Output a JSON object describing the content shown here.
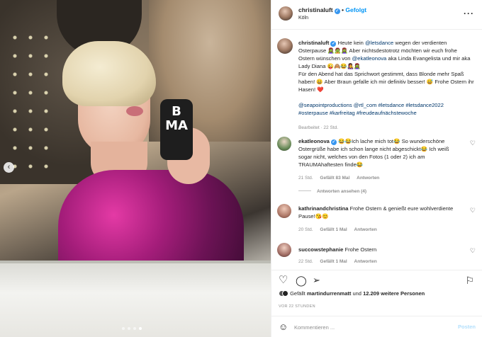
{
  "media": {
    "phone_text": "B\nMA",
    "carousel": {
      "slides": 4,
      "active_index": 3
    }
  },
  "post": {
    "author": "christinaluft",
    "follow_status": "Gefolgt",
    "location": "Köln",
    "more_icon": "more-horizontal-icon"
  },
  "caption": {
    "author": "christinaluft",
    "p1_a": "Heute kein ",
    "p1_tag": "@letsdance",
    "p1_b": " wegen der verdienten Osterpause 🧟‍♀️🧟🧟‍♀️ Aber nichtsdestotrotz möchten wir euch frohe Ostern wünschen von ",
    "p1_tag2": "@ekatleonova",
    "p1_c": " aka Linda Evangelista und mir aka Lady Diana 😜🙈😂👩‍🎤🧟‍♀️",
    "p2": "Für den Abend hat das Sprichwort gestimmt, dass Blonde mehr Spaß haben! 😄 Aber Braun gefalle ich mir definitiv besser! 😅 Frohe Ostern ihr Hasen! ❤️",
    "tags": "@seapointproductions @rtl_com #letsdance #letsdance2022 #osterpause #karfreitag #freudeaufnächstewoche",
    "edited": "Bearbeitet · 22 Std."
  },
  "comments": [
    {
      "author": "ekatleonova",
      "text": "😂😂Ich lache mich tot😂 So wunderschöne Ostergrüße habe ich schon lange nicht abgeschickt😂 Ich weiß sogar nicht, welches von den Fotos (1 oder 2) ich am TRAUMAhaftesten finde😂",
      "time": "21 Std.",
      "likes": "Gefällt 83 Mal",
      "reply": "Antworten",
      "replies": "Antworten ansehen (4)"
    },
    {
      "author": "kathrinandchristina",
      "text": "Frohe Ostern & genießt eure wohlverdiente Pause!😘😊",
      "time": "20 Std.",
      "likes": "Gefällt 1 Mal",
      "reply": "Antworten"
    },
    {
      "author": "succowstephanie",
      "text": "Frohe Ostern",
      "time": "22 Std.",
      "likes": "Gefällt 1 Mal",
      "reply": "Antworten"
    }
  ],
  "likes": {
    "prefix": "Gefällt ",
    "first_user": "martindurrenmatt",
    "middle": " und ",
    "count": "12.209 weitere Personen"
  },
  "date": "VOR 22 STUNDEN",
  "add_comment": {
    "placeholder": "Kommentieren ...",
    "post_label": "Posten"
  }
}
